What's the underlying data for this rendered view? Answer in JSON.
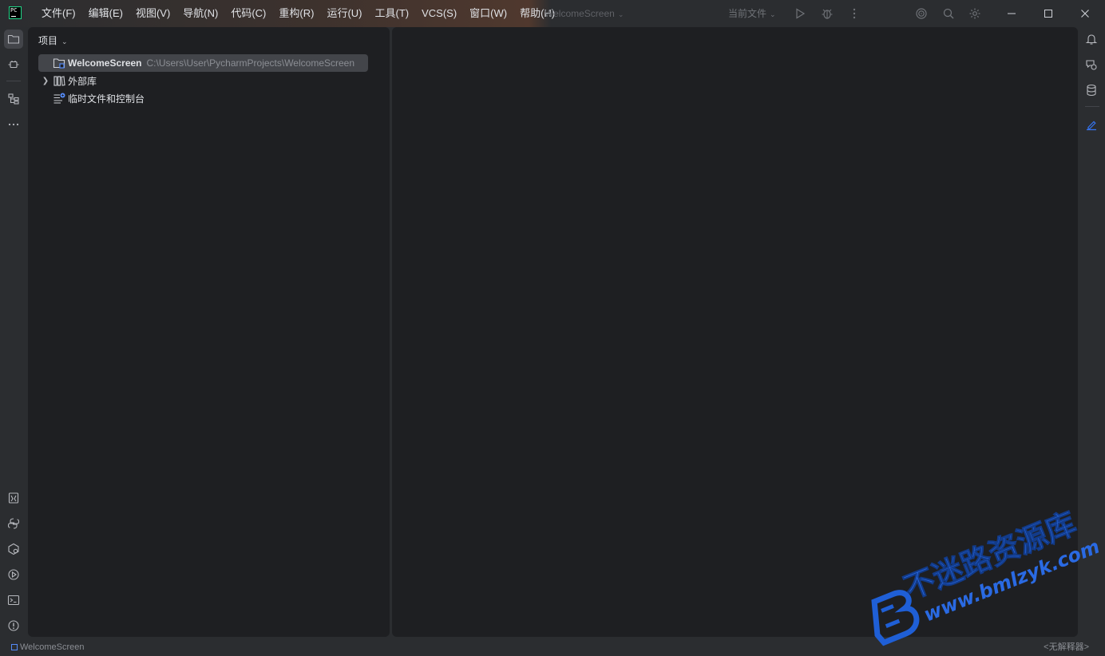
{
  "titlebar": {
    "logo_text": "PC",
    "menu": [
      "文件(F)",
      "编辑(E)",
      "视图(V)",
      "导航(N)",
      "代码(C)",
      "重构(R)",
      "运行(U)",
      "工具(T)",
      "VCS(S)",
      "窗口(W)",
      "帮助(H)"
    ],
    "project_name": "WelcomeScreen",
    "run_config": "当前文件"
  },
  "project_panel": {
    "header": "项目",
    "tree": [
      {
        "label": "WelcomeScreen",
        "path": "C:\\Users\\User\\PycharmProjects\\WelcomeScreen",
        "selected": true,
        "expandable": false
      },
      {
        "label": "外部库",
        "path": "",
        "selected": false,
        "expandable": true
      },
      {
        "label": "临时文件和控制台",
        "path": "",
        "selected": false,
        "expandable": false
      }
    ]
  },
  "statusbar": {
    "breadcrumb": "WelcomeScreen",
    "interpreter": "<无解释器>"
  },
  "watermark": {
    "title": "不迷路资源库",
    "url": "www.bmlzyk.com"
  },
  "colors": {
    "chrome": "#2b2d30",
    "panel": "#1e1f22",
    "selection": "#43454a",
    "accent": "#548af7",
    "logo_green": "#21d789"
  }
}
